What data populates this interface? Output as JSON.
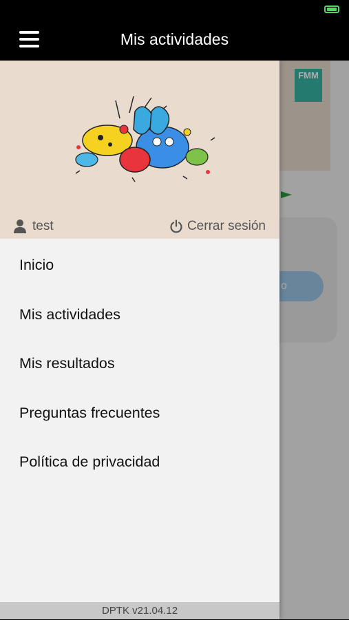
{
  "header": {
    "title": "Mis actividades",
    "menu_icon": "hamburger-menu-icon"
  },
  "status_bar": {
    "battery_icon": "battery-icon",
    "battery_color": "#4cd964"
  },
  "drawer": {
    "user": {
      "icon": "user-icon",
      "name": "test"
    },
    "logout": {
      "icon": "power-icon",
      "label": "Cerrar sesión"
    },
    "menu": [
      {
        "label": "Inicio"
      },
      {
        "label": "Mis actividades"
      },
      {
        "label": "Mis resultados"
      },
      {
        "label": "Preguntas frecuentes"
      },
      {
        "label": "Política de privacidad"
      }
    ],
    "version": "DPTK v21.04.12"
  },
  "background": {
    "logo_text": "FMM",
    "brand_color": "#36b7a4"
  },
  "colors": {
    "drawer_header_bg": "#e9dccf",
    "drawer_bg": "#f2f2f2",
    "header_bg": "#000000"
  }
}
